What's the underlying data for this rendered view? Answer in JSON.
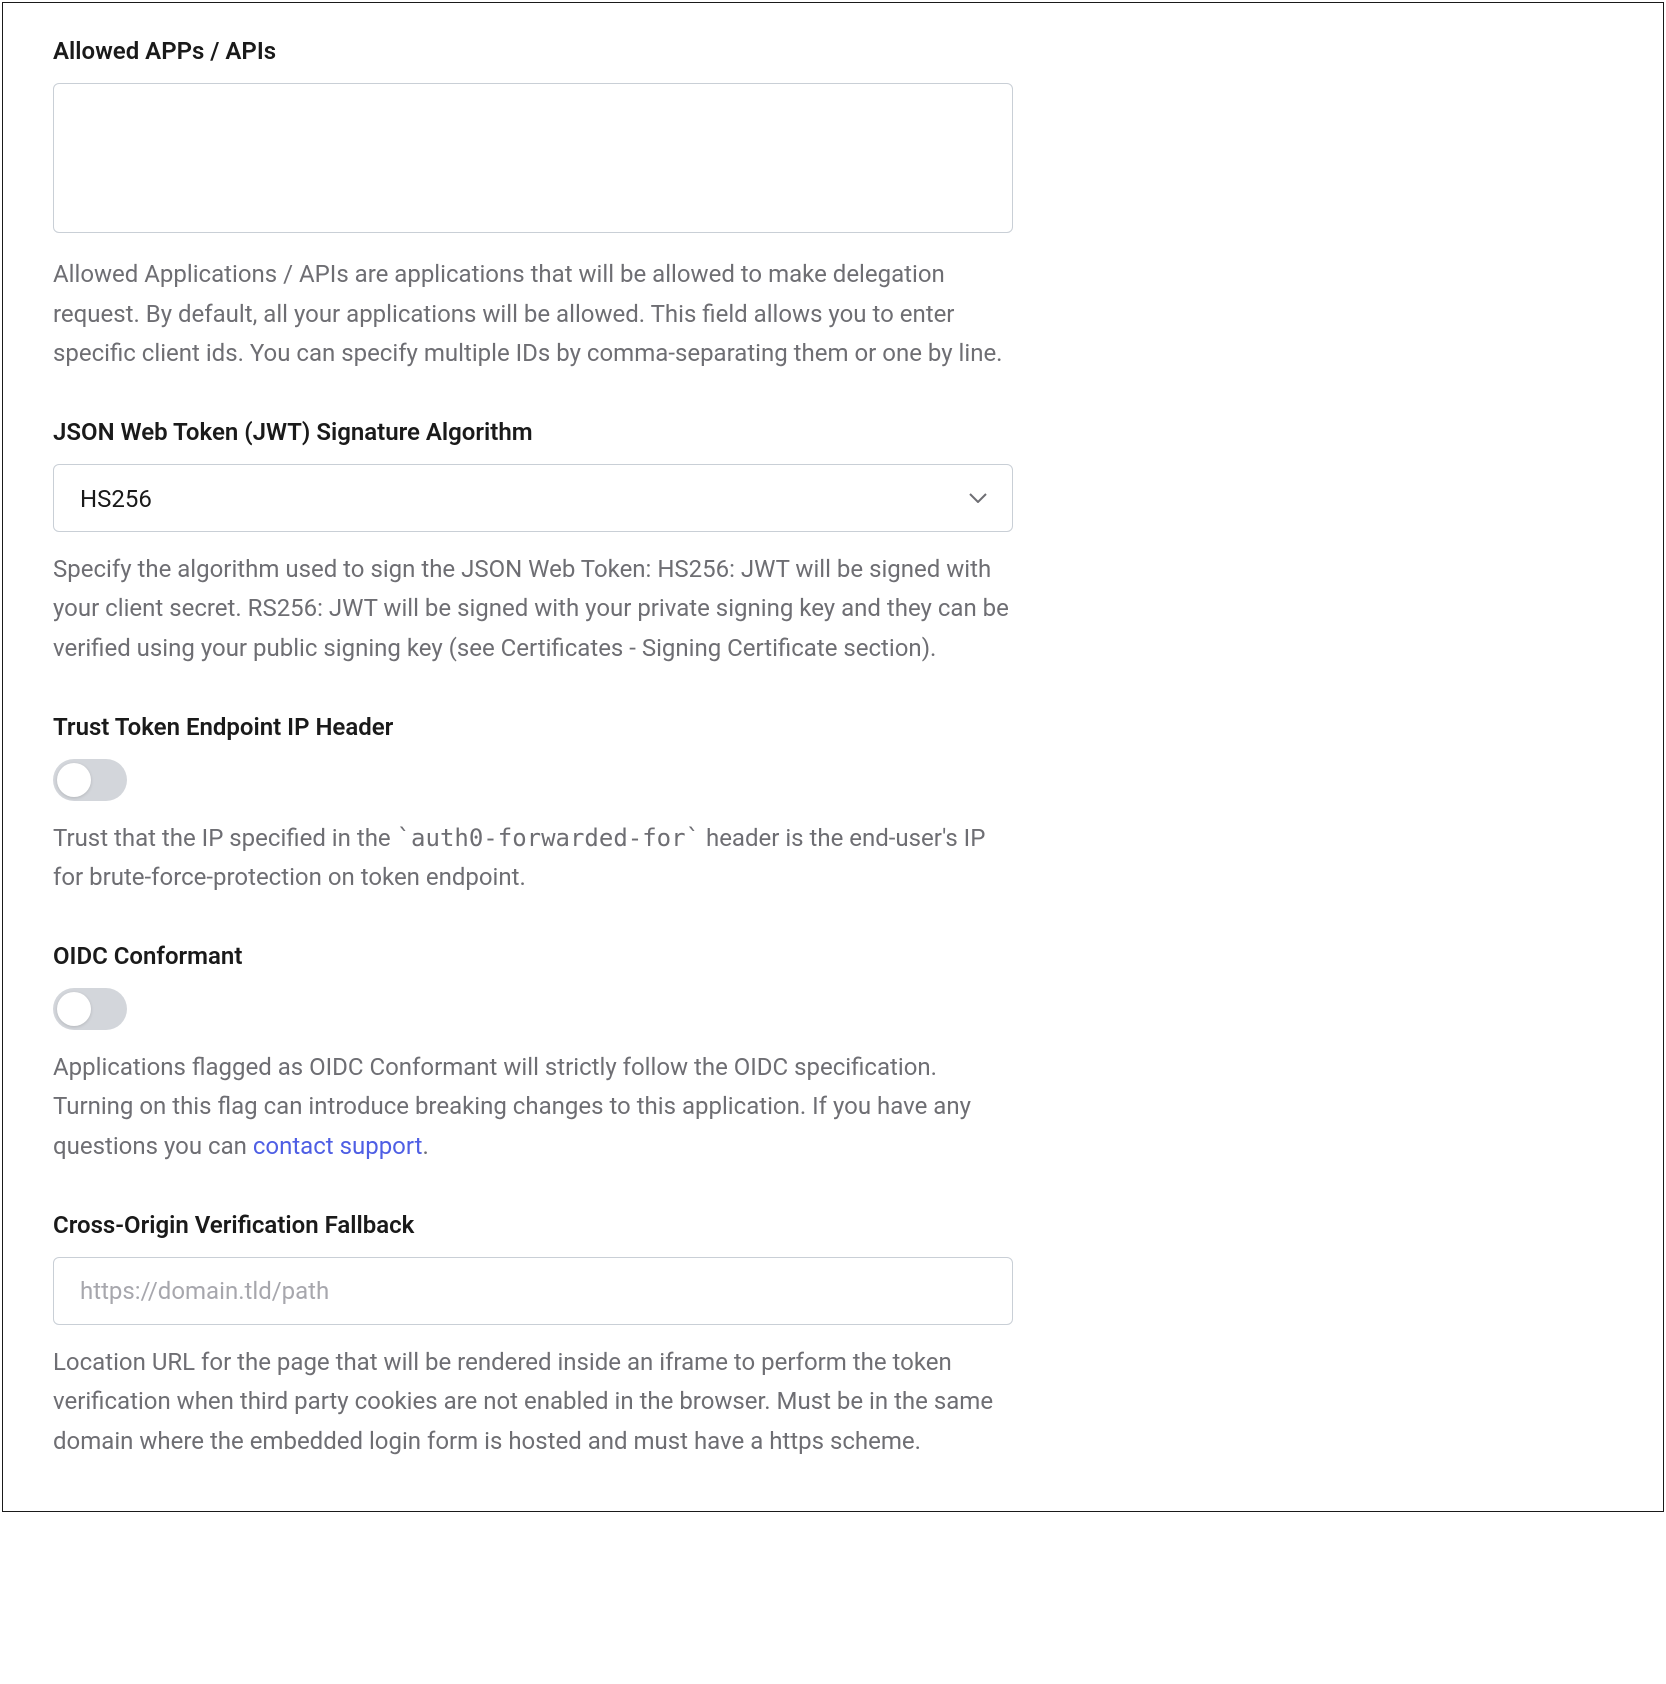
{
  "allowed_apps": {
    "label": "Allowed APPs / APIs",
    "value": "",
    "help": "Allowed Applications / APIs are applications that will be allowed to make delegation request. By default, all your applications will be allowed. This field allows you to enter specific client ids. You can specify multiple IDs by comma-separating them or one by line."
  },
  "jwt_alg": {
    "label": "JSON Web Token (JWT) Signature Algorithm",
    "value": "HS256",
    "help": "Specify the algorithm used to sign the JSON Web Token: HS256: JWT will be signed with your client secret. RS256: JWT will be signed with your private signing key and they can be verified using your public signing key (see Certificates - Signing Certificate section)."
  },
  "trust_ip": {
    "label": "Trust Token Endpoint IP Header",
    "enabled": false,
    "help_pre": "Trust that the IP specified in the ",
    "help_code": "`auth0-forwarded-for`",
    "help_post": " header is the end-user's IP for brute-force-protection on token endpoint."
  },
  "oidc": {
    "label": "OIDC Conformant",
    "enabled": false,
    "help_pre": "Applications flagged as OIDC Conformant will strictly follow the OIDC specification. Turning on this flag can introduce breaking changes to this application. If you have any questions you can ",
    "help_link": "contact support",
    "help_post": "."
  },
  "cross_origin": {
    "label": "Cross-Origin Verification Fallback",
    "value": "",
    "placeholder": "https://domain.tld/path",
    "help": "Location URL for the page that will be rendered inside an iframe to perform the token verification when third party cookies are not enabled in the browser. Must be in the same domain where the embedded login form is hosted and must have a https scheme."
  }
}
